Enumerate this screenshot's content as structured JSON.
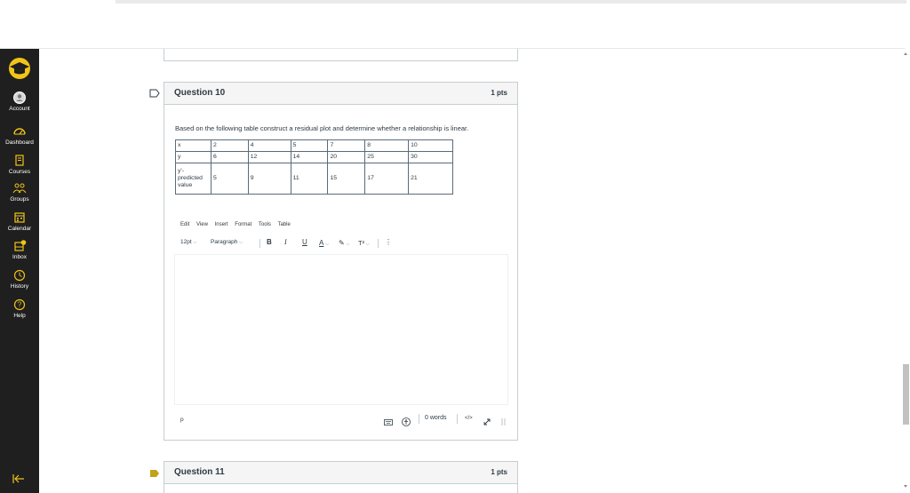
{
  "nav": {
    "account": "Account",
    "dashboard": "Dashboard",
    "courses": "Courses",
    "groups": "Groups",
    "calendar": "Calendar",
    "inbox": "Inbox",
    "history": "History",
    "help": "Help",
    "accent_color": "#f0c419",
    "background_color": "#1f1f1f"
  },
  "question10": {
    "title": "Question 10",
    "points": "1 pts",
    "text": "Based on the following table construct a residual plot and determine whether a relationship is linear.",
    "table": [
      [
        "x",
        "2",
        "4",
        "5",
        "7",
        "8",
        "10"
      ],
      [
        "y",
        "6",
        "12",
        "14",
        "20",
        "25",
        "30"
      ],
      [
        "y'- predicted value",
        "5",
        "9",
        "11",
        "15",
        "17",
        "21"
      ]
    ],
    "row3_label_lines": [
      "y'-",
      "predicted",
      "value"
    ],
    "menubar": [
      "Edit",
      "View",
      "Insert",
      "Format",
      "Tools",
      "Table"
    ],
    "toolbar": {
      "font_size": "12pt",
      "block_format": "Paragraph",
      "bold": "B",
      "italic": "I",
      "underline": "U",
      "text_color": "A",
      "superscript": "T²",
      "more": "⋮"
    },
    "status": {
      "element_path": "p",
      "word_count": "0 words",
      "html_toggle": "</>",
      "icons": [
        "keyboard-icon",
        "accessibility-icon",
        "fullscreen-icon",
        "resize-grip-icon"
      ]
    }
  },
  "question11": {
    "title": "Question 11",
    "points": "1 pts"
  },
  "flag_color": "#c3a21a"
}
